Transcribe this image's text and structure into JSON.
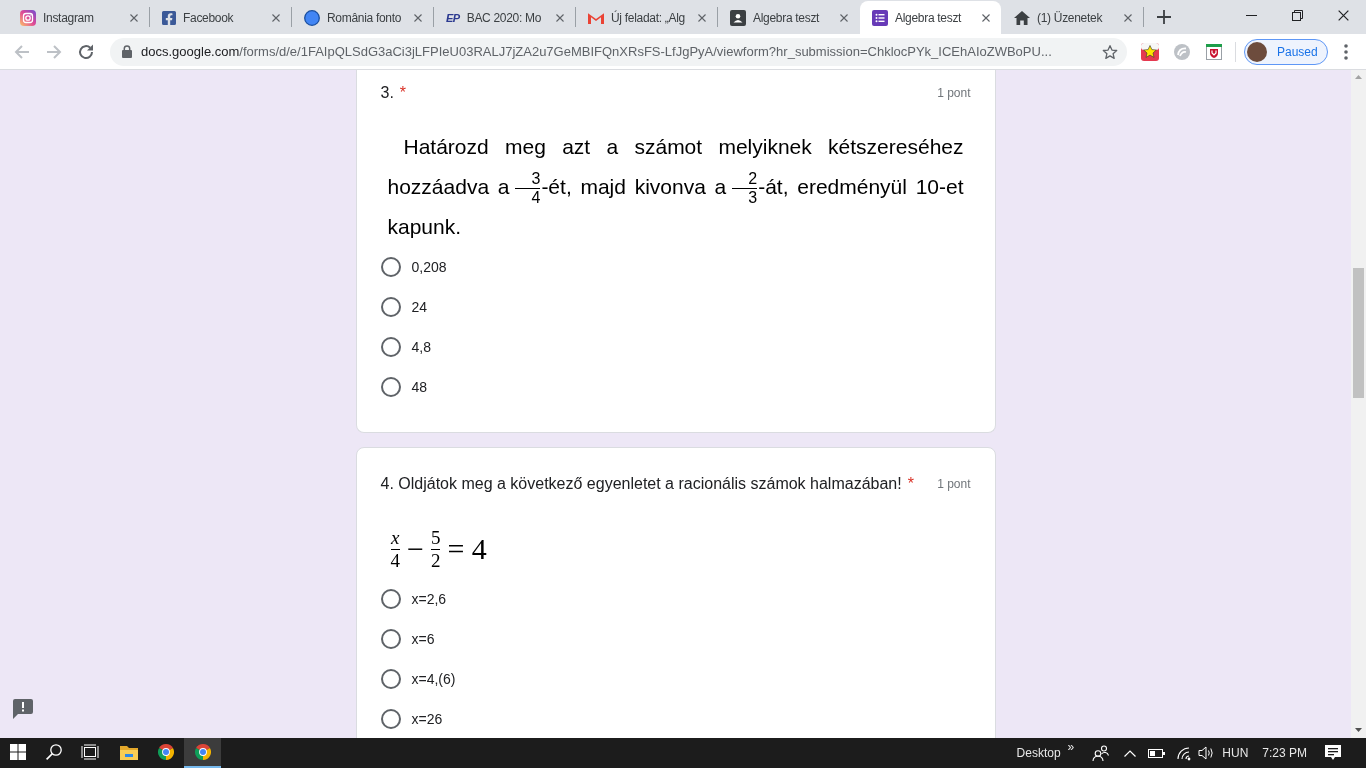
{
  "browser": {
    "tabs": [
      {
        "kind": "camera",
        "title": "Instagram",
        "selected": false
      },
      {
        "kind": "f-logo",
        "title": "Facebook",
        "selected": false
      },
      {
        "kind": "circle",
        "title": "România fonto",
        "selected": false
      },
      {
        "kind": "text-logo",
        "logo": "EP",
        "title": "BAC 2020: Mo",
        "selected": false
      },
      {
        "kind": "mail",
        "title": "Új feladat: „Alg",
        "selected": false
      },
      {
        "kind": "contact-card",
        "title": "Algebra teszt",
        "selected": false
      },
      {
        "kind": "form-list",
        "title": "Algebra teszt",
        "selected": true
      },
      {
        "kind": "home",
        "title": "(1) Üzenetek",
        "selected": false
      }
    ],
    "navigation": {
      "back": {
        "disabled": true
      },
      "forward": {
        "disabled": true
      }
    },
    "address_bar": {
      "host": "docs.google.com",
      "path": "/forms/d/e/1FAIpQLSdG3aCi3jLFPIeU03RALJ7jZA2u7GeMBIFQnXRsFS-LfJgPyA/viewform?hr_submission=ChklocPYk_ICEhAIoZWBoPU..."
    },
    "extensions": [
      {
        "kind": "star-badge"
      },
      {
        "kind": "round-logo"
      },
      {
        "kind": "shield"
      }
    ],
    "profile": {
      "status": "Paused"
    }
  },
  "form": {
    "questions": [
      {
        "title": "3.",
        "required_mark": "*",
        "points": "1 pont",
        "body": {
          "kind": "paragraph",
          "segments": [
            {
              "kind": "text",
              "text": "Határozd meg azt a számot melyiknek kétszereséhez hozzáadva a"
            },
            {
              "kind": "fraction",
              "numerator": "3",
              "denominator": "4"
            },
            {
              "kind": "text",
              "text": "-ét, majd kivonva a"
            },
            {
              "kind": "fraction",
              "numerator": "2",
              "denominator": "3"
            },
            {
              "kind": "text",
              "text": "-át, eredményül 10-et kapunk."
            }
          ]
        },
        "options": [
          {
            "label": "0,208",
            "selected": false
          },
          {
            "label": "24",
            "selected": false
          },
          {
            "label": "4,8",
            "selected": false
          },
          {
            "label": "48",
            "selected": false
          }
        ]
      },
      {
        "title": "4. Oldjátok meg a következő egyenletet a racionális számok halmazában!",
        "required_mark": "*",
        "points": "1 pont",
        "body": {
          "kind": "equation",
          "segments": [
            {
              "kind": "fraction",
              "numerator": "*x*",
              "denominator": "4"
            },
            {
              "kind": "text",
              "text": "−"
            },
            {
              "kind": "fraction",
              "numerator": "5",
              "denominator": "2"
            },
            {
              "kind": "text",
              "text": "= 4"
            }
          ]
        },
        "options": [
          {
            "label": "x=2,6",
            "selected": false
          },
          {
            "label": "x=6",
            "selected": false
          },
          {
            "label": "x=4,(6)",
            "selected": false
          },
          {
            "label": "x=26",
            "selected": false
          }
        ]
      }
    ]
  },
  "taskbar": {
    "apps": [
      {
        "kind": "start",
        "selected": false
      },
      {
        "kind": "search",
        "selected": false
      },
      {
        "kind": "task-view",
        "selected": false
      },
      {
        "kind": "files",
        "selected": false
      },
      {
        "kind": "browser",
        "selected": false
      },
      {
        "kind": "browser",
        "selected": true
      }
    ],
    "toolbar": "Desktop",
    "toolbar_more": "»",
    "language": "HUN",
    "time": "7:23 PM"
  }
}
